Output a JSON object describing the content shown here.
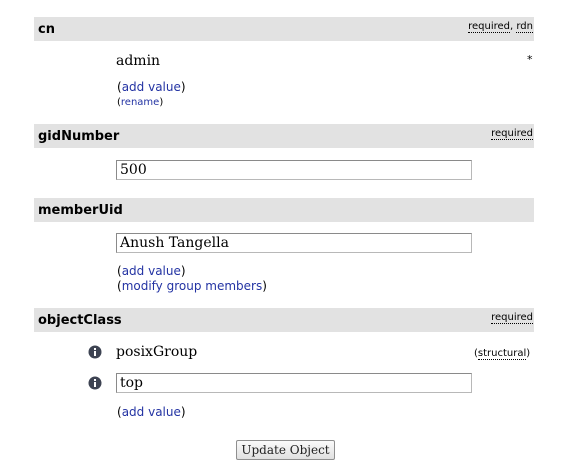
{
  "attributes": {
    "cn": {
      "name": "cn",
      "flag_required": "required",
      "flag_separator": ", ",
      "flag_rdn": "rdn",
      "value": "admin",
      "required_marker": "*",
      "add_value": "add value",
      "rename": "rename"
    },
    "gidNumber": {
      "name": "gidNumber",
      "flag_required": "required",
      "value": "500"
    },
    "memberUid": {
      "name": "memberUid",
      "value": "Anush Tangella",
      "add_value": "add value",
      "modify_members": "modify group members"
    },
    "objectClass": {
      "name": "objectClass",
      "flag_required": "required",
      "values": [
        {
          "value": "posixGroup",
          "note": "structural",
          "icon": "info-icon"
        },
        {
          "value": "top",
          "icon": "info-icon"
        }
      ],
      "add_value": "add value"
    }
  },
  "submit": {
    "label": "Update Object"
  },
  "punct": {
    "open": "(",
    "close": ")"
  },
  "colors": {
    "header_bg": "#e2e2e2",
    "link": "#2333a3",
    "info_icon": "#3d4352"
  }
}
